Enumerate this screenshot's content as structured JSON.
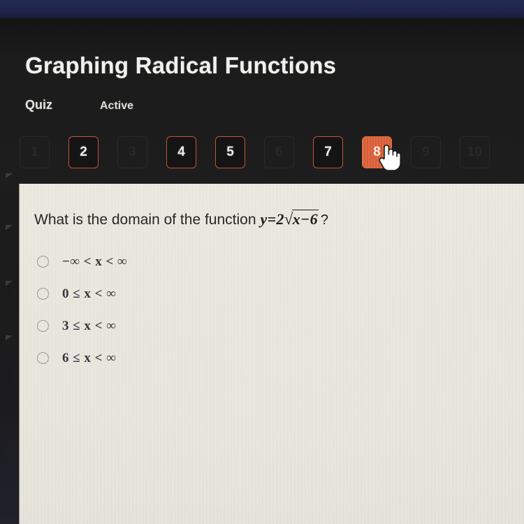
{
  "header": {
    "title": "Graphing Radical Functions",
    "kicker": "Quiz",
    "status": "Active"
  },
  "pager": {
    "items": [
      {
        "label": "1",
        "state": "dim"
      },
      {
        "label": "2",
        "state": "outline"
      },
      {
        "label": "3",
        "state": "dim"
      },
      {
        "label": "4",
        "state": "outline"
      },
      {
        "label": "5",
        "state": "outline"
      },
      {
        "label": "6",
        "state": "dim"
      },
      {
        "label": "7",
        "state": "outline"
      },
      {
        "label": "8",
        "state": "filled"
      },
      {
        "label": "9",
        "state": "dim"
      },
      {
        "label": "10",
        "state": "dim"
      }
    ],
    "selected": "8"
  },
  "question": {
    "prompt": "What is the domain of the function",
    "formula": {
      "lhs": "y",
      "equals": "=",
      "coefficient": "2",
      "radical_sign": "√",
      "radicand": "x−6",
      "trailing": "?"
    },
    "formula_plain": "y = 2√(x−6)?"
  },
  "answers": {
    "options": [
      {
        "text": "−∞ < x < ∞",
        "selected": false
      },
      {
        "text": "0 ≤ x < ∞",
        "selected": false
      },
      {
        "text": "3 ≤ x < ∞",
        "selected": false
      },
      {
        "text": "6 ≤ x < ∞",
        "selected": false
      }
    ]
  },
  "colors": {
    "accent_orange": "#e06a42",
    "header_dark": "#1c1c1c",
    "top_navy": "#1e2449",
    "panel_cream": "#e9e7dc",
    "text_dark": "#262625"
  },
  "cursor": {
    "type": "hand-pointer",
    "over": "8"
  }
}
